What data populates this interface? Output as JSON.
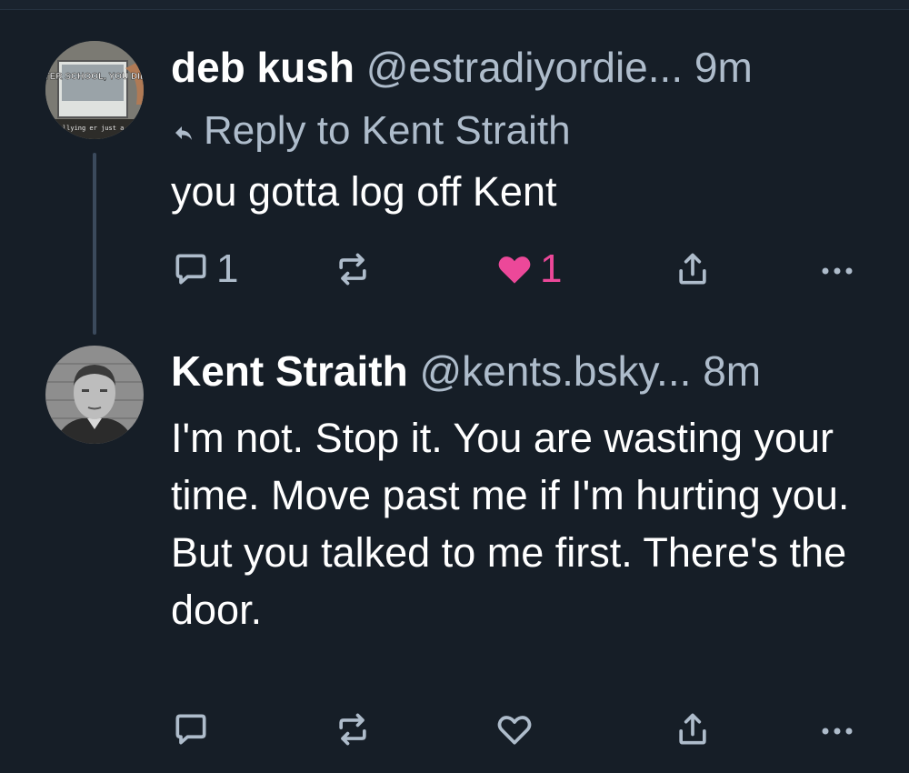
{
  "posts": [
    {
      "author_name": "deb kush",
      "handle": "@estradiyordie...",
      "time": "9m",
      "reply_to_label": "Reply to Kent Straith",
      "text": "you gotta log off Kent",
      "avatar_caption_top": "AFTER SCHOOL, YOU DIE!\"",
      "avatar_caption_bottom": "ber bullying er just a",
      "reply_count": "1",
      "like_count": "1",
      "liked": true
    },
    {
      "author_name": "Kent Straith",
      "handle": "@kents.bsky...",
      "time": "8m",
      "text": "I'm not. Stop it. You are wasting your time. Move past me if I'm hurting you. But you talked to me first. There's the door.",
      "reply_count": "",
      "like_count": "",
      "liked": false
    }
  ],
  "colors": {
    "background": "#161e27",
    "muted": "#aebccb",
    "like": "#ec4899",
    "thread_line": "#3b4a5c"
  },
  "icons": {
    "reply": "reply-arrow-icon",
    "comment": "comment-icon",
    "repost": "repost-icon",
    "like": "heart-icon",
    "share": "share-icon",
    "more": "more-icon"
  }
}
